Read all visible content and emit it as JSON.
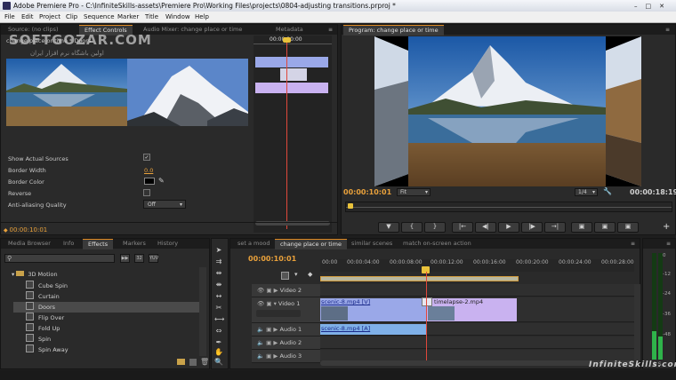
{
  "window": {
    "title": "Adobe Premiere Pro - C:\\InfiniteSkills-assets\\Premiere Pro\\Working Files\\projects\\0804-adjusting transitions.prproj *"
  },
  "menu": [
    "File",
    "Edit",
    "Project",
    "Clip",
    "Sequence",
    "Marker",
    "Title",
    "Window",
    "Help"
  ],
  "source_panel": {
    "tabs": [
      "Source: (no clips)",
      "Effect Controls",
      "Audio Mixer: change place or time",
      "Metadata"
    ],
    "header": "change place or time * Doors",
    "mini_ruler": "00:00:10:00",
    "props": [
      {
        "label": "Show Actual Sources",
        "value": "✓"
      },
      {
        "label": "Border Width",
        "value": "0.0"
      },
      {
        "label": "Border Color",
        "value": ""
      },
      {
        "label": "Reverse",
        "value": ""
      },
      {
        "label": "Anti-aliasing Quality",
        "value": "Off"
      }
    ],
    "timecode": "00:00:10:01"
  },
  "program": {
    "tab": "Program: change place or time",
    "timecode_current": "00:00:10:01",
    "fit": "Fit",
    "resolution": "1/4",
    "timecode_duration": "00:00:18:19",
    "transport": [
      "▼",
      "{",
      "}",
      "|←",
      "◀|",
      "▶",
      "|▶",
      "→|",
      "▣",
      "▣",
      "▣"
    ]
  },
  "project_panel": {
    "tabs": [
      "Media Browser",
      "Info",
      "Effects",
      "Markers",
      "History"
    ],
    "search_placeholder": "",
    "folder": "3D Motion",
    "items": [
      "Cube Spin",
      "Curtain",
      "Doors",
      "Flip Over",
      "Fold Up",
      "Spin",
      "Spin Away"
    ]
  },
  "timeline": {
    "tabs": [
      "set a mood",
      "change place or time",
      "similar scenes",
      "match on-screen action"
    ],
    "timecode": "00:00:10:01",
    "ruler": [
      "00:00",
      "00:00:04:00",
      "00:00:08:00",
      "00:00:12:00",
      "00:00:16:00",
      "00:00:20:00",
      "00:00:24:00",
      "00:00:28:00"
    ],
    "tracks": [
      "Video 2",
      "Video 1",
      "Audio 1",
      "Audio 2",
      "Audio 3"
    ],
    "clips": {
      "v1a": "scenic-8.mp4 [V]",
      "v1b": "timelapse-2.mp4",
      "a1": "scenic-8.mp4 [A]"
    }
  },
  "meter": {
    "labels": [
      "0",
      "-12",
      "-24",
      "-36",
      "-48"
    ],
    "foot": "S S"
  },
  "watermarks": {
    "top": "SOFTGOZAR.COM",
    "sub": "اولین باشگاه نرم افزار ایران",
    "bottom": "InfiniteSkills.com"
  },
  "colors": {
    "accent": "#e9a13b",
    "clip_video": "#9aa8e8",
    "clip_audio": "#7fb0e8",
    "clip_transition": "#c9b2f0"
  }
}
